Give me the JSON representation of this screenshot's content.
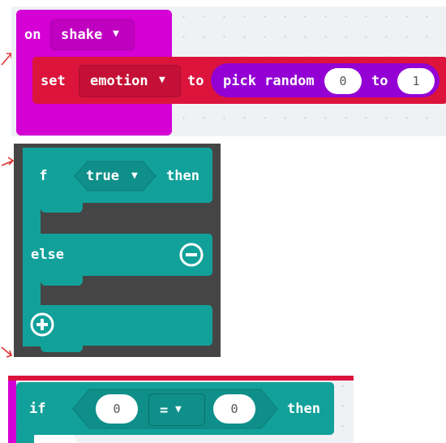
{
  "block_on_shake": {
    "keyword_on": "on",
    "event_dropdown": "shake",
    "keyword_set": "set",
    "variable_dropdown": "emotion",
    "keyword_to": "to",
    "function_label": "pick random",
    "random_from": "0",
    "keyword_to2": "to",
    "random_to": "1"
  },
  "block_if_else": {
    "keyword_if": "if",
    "condition_dropdown": "true",
    "keyword_then": "then",
    "keyword_else": "else",
    "remove_icon": "minus-circle-icon",
    "add_icon": "plus-circle-icon"
  },
  "block_if_compare": {
    "keyword_if": "if",
    "left_value": "0",
    "operator": "=",
    "right_value": "0",
    "keyword_then": "then"
  },
  "colors": {
    "event_magenta": "#d400d4",
    "set_red": "#dc143c",
    "math_purple": "#9400d3",
    "logic_teal": "#12a19a",
    "dark_frame": "#454545"
  }
}
